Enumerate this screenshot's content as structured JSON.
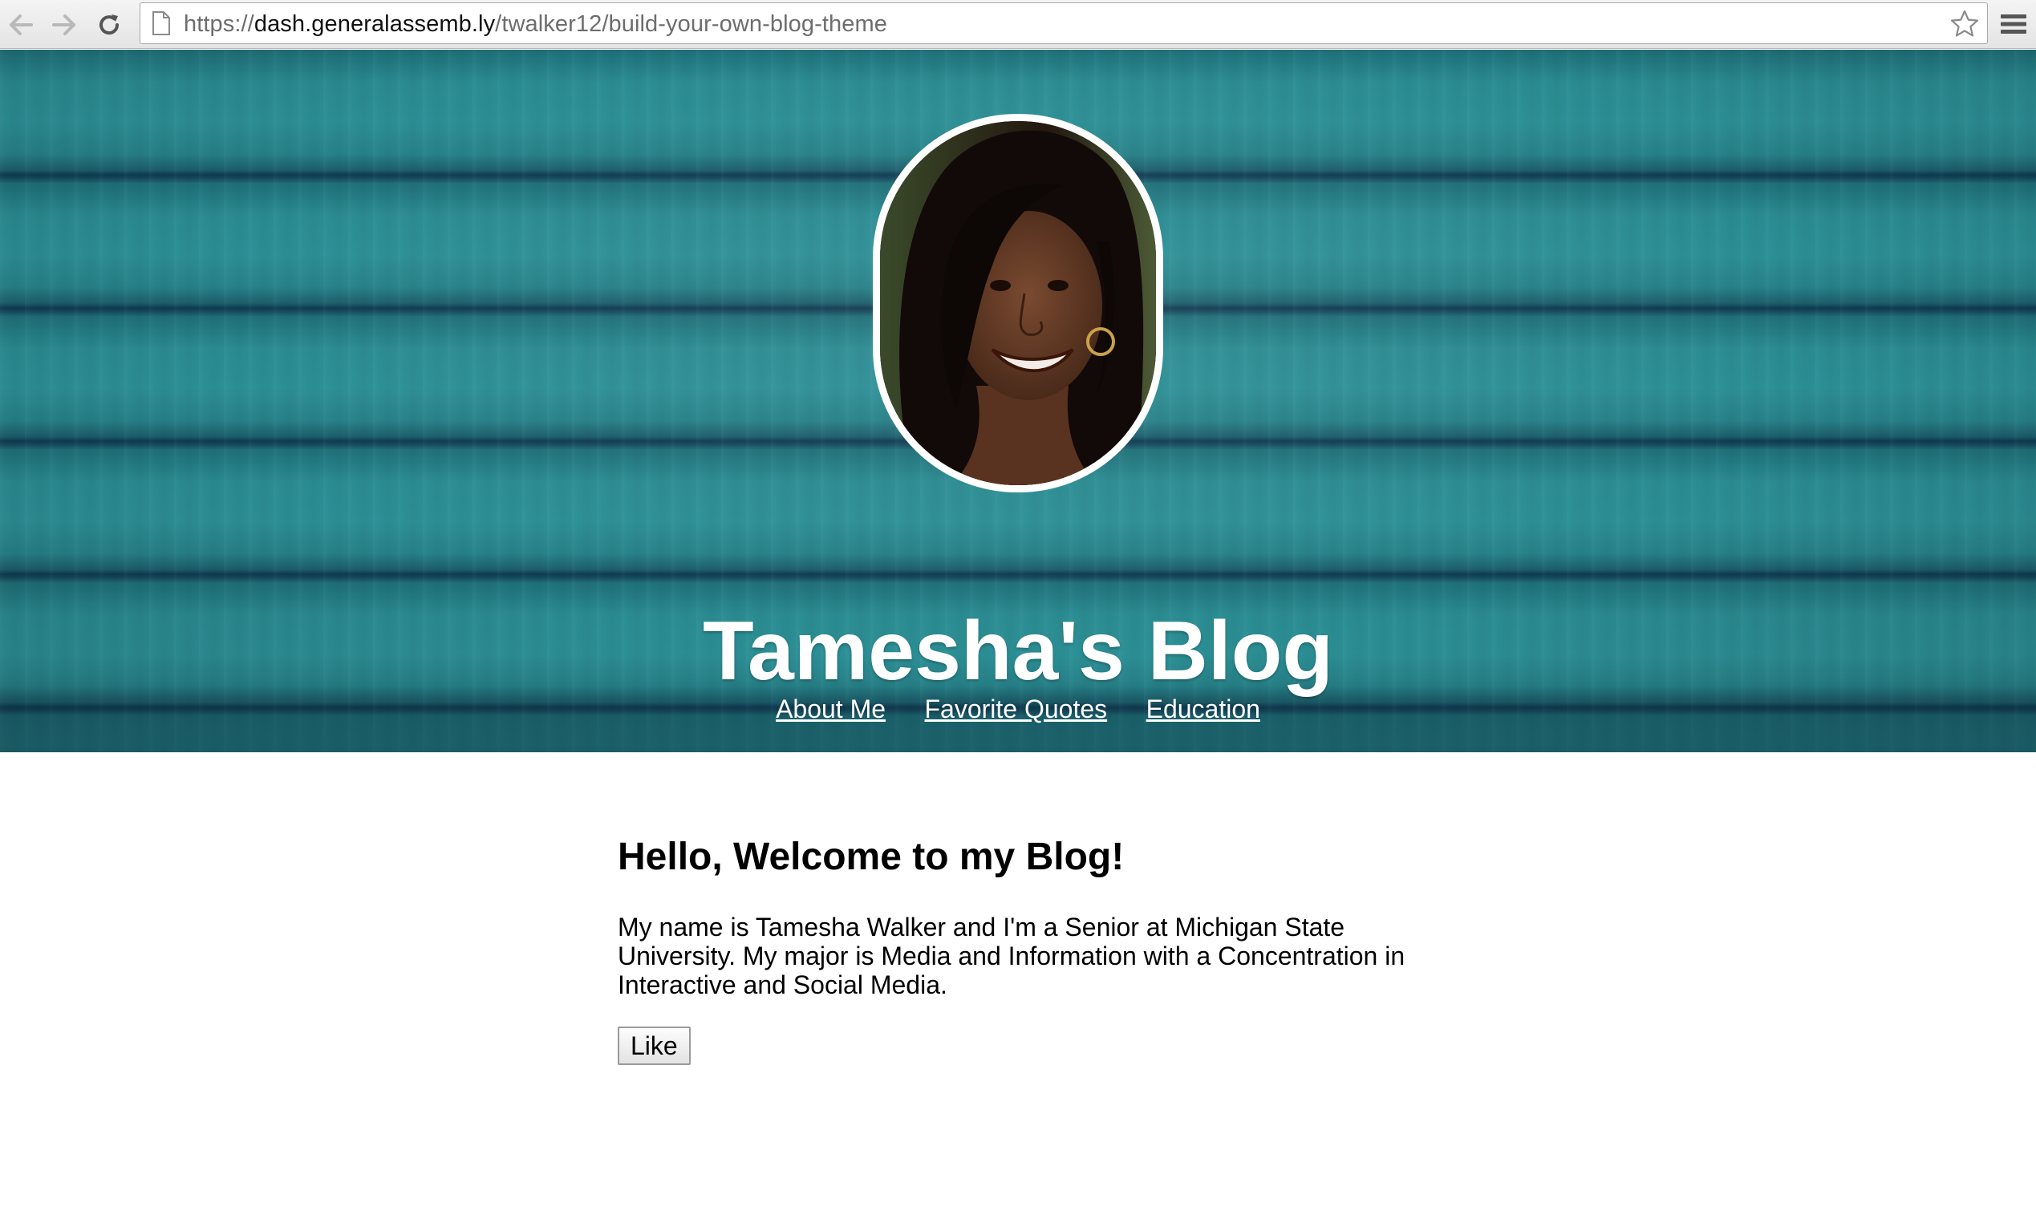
{
  "browser": {
    "url_scheme": "https://",
    "url_host": "dash.generalassemb.ly",
    "url_path": "/twalker12/build-your-own-blog-theme",
    "icons": [
      "back-arrow-icon",
      "forward-arrow-icon",
      "reload-icon",
      "page-icon",
      "star-icon",
      "menu-icon"
    ]
  },
  "header": {
    "title": "Tamesha's Blog",
    "avatar": "profile-photo",
    "nav": [
      {
        "label": "About Me"
      },
      {
        "label": "Favorite Quotes"
      },
      {
        "label": "Education"
      }
    ]
  },
  "main": {
    "heading": "Hello, Welcome to my Blog!",
    "intro": "My name is Tamesha Walker and I'm a Senior at Michigan State University. My major is Media and Information with a Concentration in Interactive and Social Media.",
    "like_label": "Like"
  },
  "colors": {
    "hero_teal": "#277f86",
    "seam_dark": "#0f3b52",
    "text_white": "#ffffff"
  }
}
